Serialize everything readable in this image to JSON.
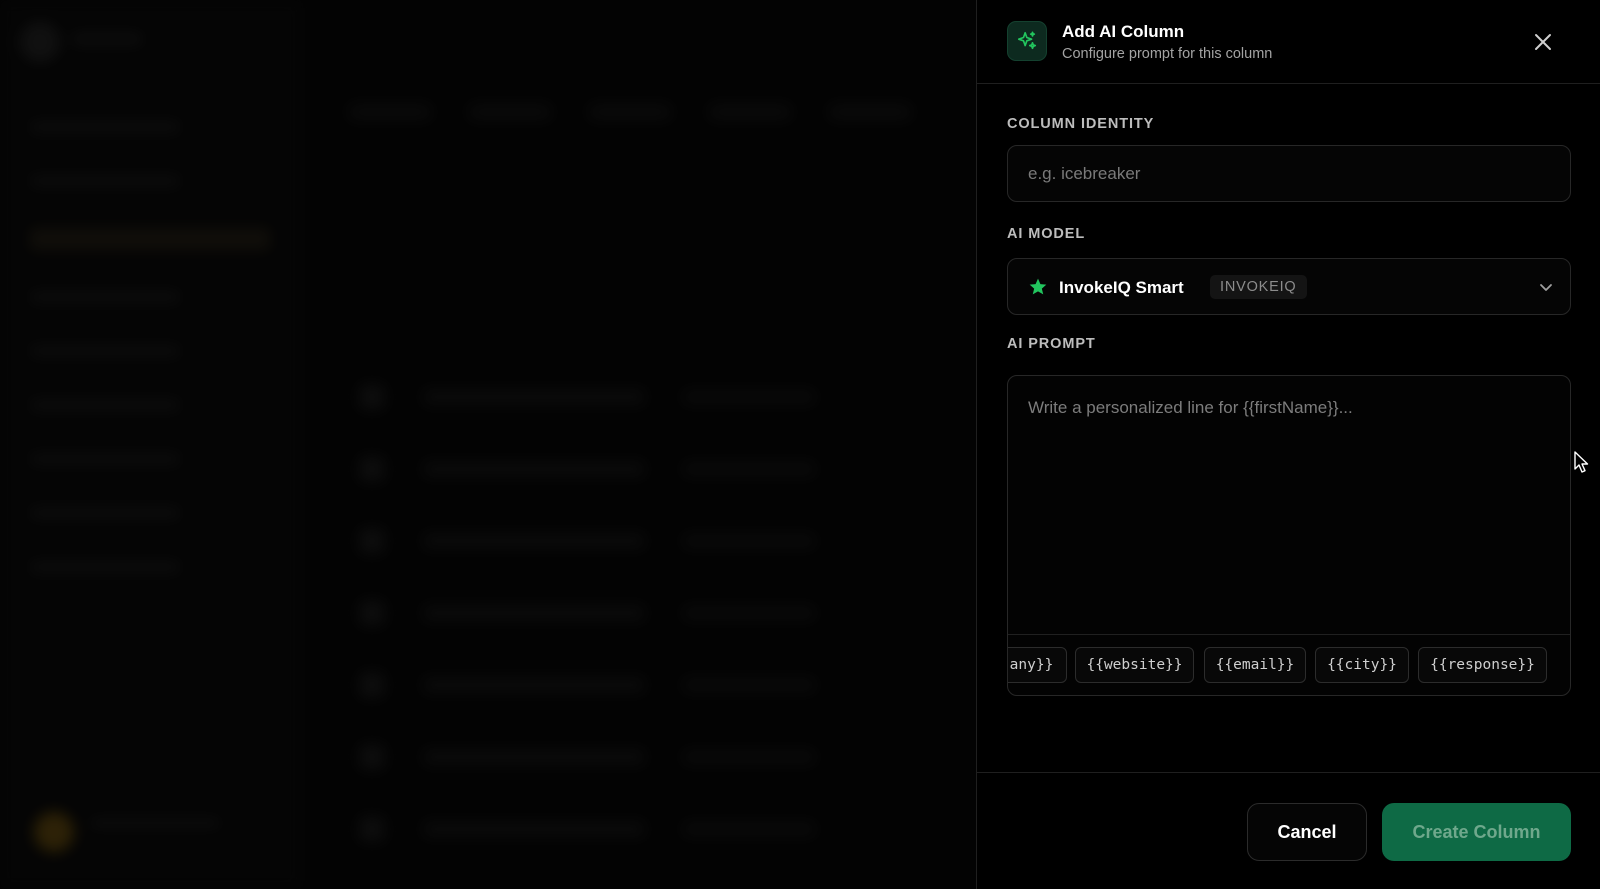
{
  "colors": {
    "accent_green": "#22c55e",
    "create_button_bg": "#0e6a45",
    "panel_bg": "#000000"
  },
  "panel": {
    "title": "Add AI Column",
    "subtitle": "Configure prompt for this column",
    "header_icon": "sparkles-icon",
    "close_icon": "close-icon"
  },
  "column_identity": {
    "label": "COLUMN IDENTITY",
    "value": "",
    "placeholder": "e.g. icebreaker"
  },
  "ai_model": {
    "label": "AI MODEL",
    "selected_name": "InvokeIQ Smart",
    "selected_badge": "INVOKEIQ",
    "icon": "star-icon",
    "chevron_icon": "chevron-down-icon"
  },
  "ai_prompt": {
    "label": "AI PROMPT",
    "value": "",
    "placeholder": "Write a personalized line for {{firstName}}...",
    "variables": [
      "any}}",
      "{{website}}",
      "{{email}}",
      "{{city}}",
      "{{response}}"
    ]
  },
  "footer": {
    "cancel_label": "Cancel",
    "create_label": "Create Column"
  }
}
